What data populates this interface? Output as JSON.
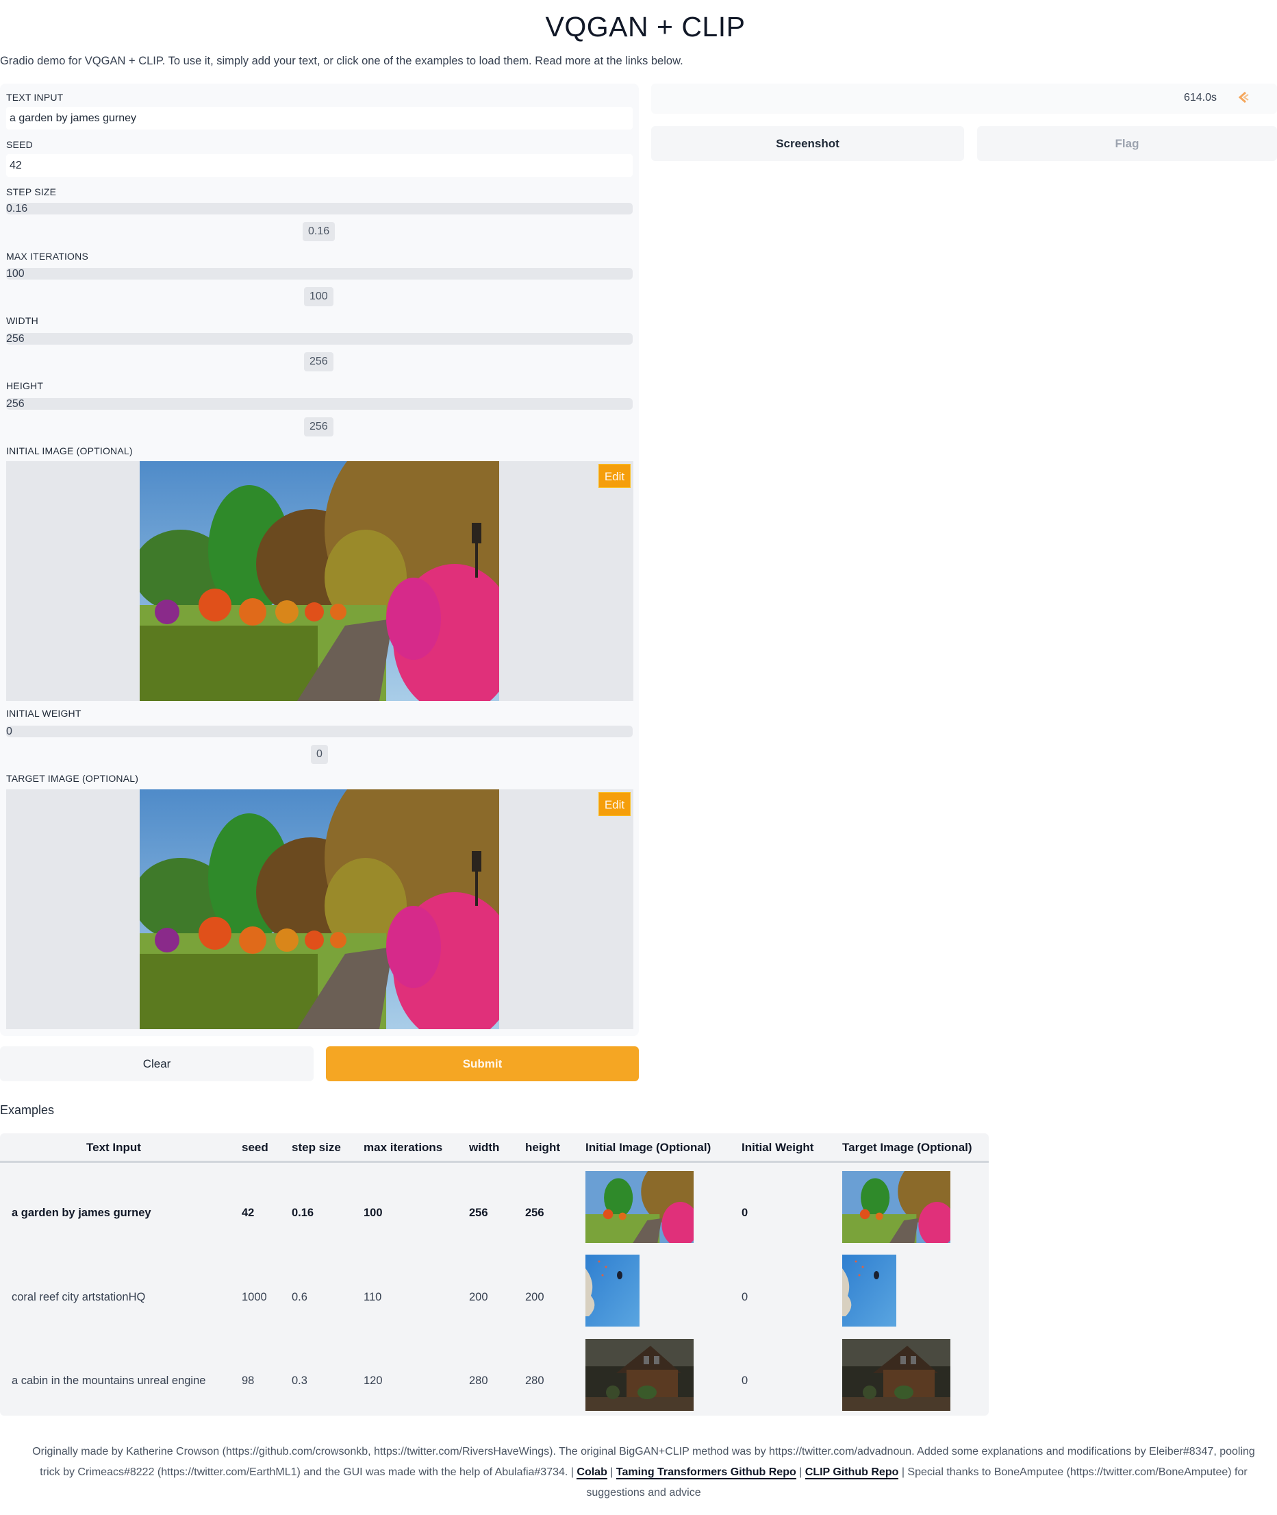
{
  "app": {
    "title": "VQGAN + CLIP",
    "description": "Gradio demo for VQGAN + CLIP. To use it, simply add your text, or click one of the examples to load them. Read more at the links below."
  },
  "inputs": {
    "text_input": {
      "label": "TEXT INPUT",
      "value": "a garden by james gurney"
    },
    "seed": {
      "label": "SEED",
      "value": "42"
    },
    "step_size": {
      "label": "STEP SIZE",
      "value": "0.16"
    },
    "max_iterations": {
      "label": "MAX ITERATIONS",
      "value": "100"
    },
    "width": {
      "label": "WIDTH",
      "value": "256"
    },
    "height": {
      "label": "HEIGHT",
      "value": "256"
    },
    "initial_image": {
      "label": "INITIAL IMAGE (OPTIONAL)",
      "edit_label": "Edit",
      "image": "garden path with flowering trees"
    },
    "initial_weight": {
      "label": "INITIAL WEIGHT",
      "value": "0"
    },
    "target_image": {
      "label": "TARGET IMAGE (OPTIONAL)",
      "edit_label": "Edit",
      "image": "garden path with flowering trees"
    }
  },
  "actions": {
    "clear_label": "Clear",
    "submit_label": "Submit"
  },
  "output": {
    "timer": "614.0s",
    "loader_icon": "loading-spinner-icon",
    "screenshot_label": "Screenshot",
    "flag_label": "Flag"
  },
  "examples": {
    "label": "Examples",
    "headers": [
      "Text Input",
      "seed",
      "step size",
      "max iterations",
      "width",
      "height",
      "Initial Image (Optional)",
      "Initial Weight",
      "Target Image (Optional)"
    ],
    "rows": [
      {
        "text": "a garden by james gurney",
        "seed": "42",
        "step": "0.16",
        "iters": "100",
        "width": "256",
        "height": "256",
        "init_image": "garden",
        "weight": "0",
        "target_image": "garden",
        "selected": true
      },
      {
        "text": "coral reef city artstationHQ",
        "seed": "1000",
        "step": "0.6",
        "iters": "110",
        "width": "200",
        "height": "200",
        "init_image": "coral reef",
        "weight": "0",
        "target_image": "coral reef",
        "selected": false
      },
      {
        "text": "a cabin in the mountains unreal engine",
        "seed": "98",
        "step": "0.3",
        "iters": "120",
        "width": "280",
        "height": "280",
        "init_image": "cabin",
        "weight": "0",
        "target_image": "cabin",
        "selected": false
      }
    ]
  },
  "footer": {
    "text1": "Originally made by Katherine Crowson (https://github.com/crowsonkb, https://twitter.com/RiversHaveWings). The original BigGAN+CLIP method was by https://twitter.com/advadnoun. Added some explanations and modifications by Eleiber#8347, pooling trick by Crimeacs#8222 (https://twitter.com/EarthML1) and the GUI was made with the help of Abulafia#3734. | ",
    "link_colab": "Colab",
    "sep": " | ",
    "link_taming": "Taming Transformers Github Repo",
    "link_clip": "CLIP Github Repo",
    "text2": " | Special thanks to BoneAmputee (https://twitter.com/BoneAmputee) for suggestions and advice"
  },
  "colors": {
    "accent": "#f5a623",
    "panel_bg": "#f8f9fb",
    "track": "#e5e7eb"
  }
}
